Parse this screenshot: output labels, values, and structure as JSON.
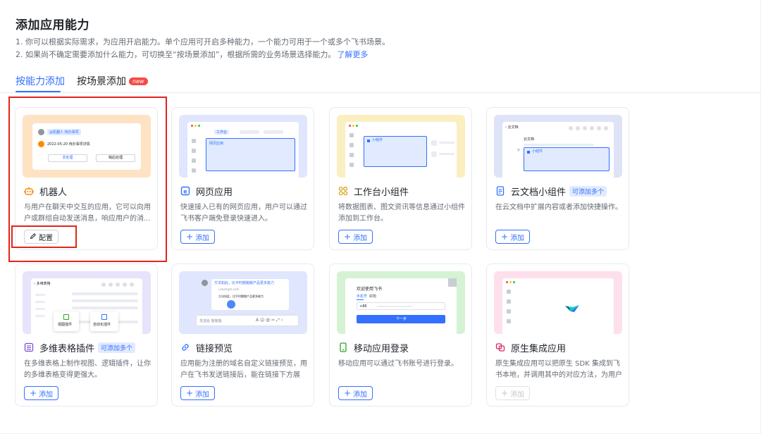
{
  "page": {
    "title": "添加应用能力",
    "desc1": "1. 你可以根据实际需求，为应用开启能力。单个应用可开启多种能力，一个能力可用于一个或多个飞书场景。",
    "desc2": "2. 如果尚不确定需要添加什么能力，可切换至“按场景添加”，根据所需的业务场景选择能力。",
    "learn_more": "了解更多"
  },
  "tabs": [
    {
      "label": "按能力添加",
      "active": true
    },
    {
      "label": "按场景添加",
      "badge": "new"
    }
  ],
  "colors": {
    "accent": "#3370ff",
    "highlight": "#e1251b",
    "badge_red": "#f54a45"
  },
  "cards": [
    {
      "title": "机器人",
      "icon": "robot-icon",
      "icon_color": "#ff8800",
      "desc": "与用户在聊天中交互的应用，它可以向用户或群组自动发送消息，响应用户的消...",
      "button": "配置",
      "button_icon": "edit-icon",
      "highlighted": true,
      "thumb_bg": "#fde2c4",
      "preview": {
        "chip": "@机器人 待办事项",
        "line": "2022-05-20 待办事项详情",
        "btn_a": "去处理",
        "btn_b": "稍后处理"
      }
    },
    {
      "title": "网页应用",
      "icon": "web-icon",
      "icon_color": "#3370ff",
      "desc": "快速接入已有的网页应用，用户可以通过飞书客户端免登录快速进入。",
      "button": "添加",
      "button_icon": "plus-icon",
      "thumb_bg": "#dfe6fd",
      "preview": {
        "tab": "工作台",
        "box": "网页应用"
      }
    },
    {
      "title": "工作台小组件",
      "icon": "widget-icon",
      "icon_color": "#d4a017",
      "desc": "将数据图表、图文资讯等信息通过小组件添加到工作台。",
      "button": "添加",
      "button_icon": "plus-icon",
      "thumb_bg": "#fbeec0",
      "preview": {
        "box": "小组件"
      }
    },
    {
      "title": "云文档小组件",
      "icon": "doc-icon",
      "icon_color": "#3370ff",
      "badge": "可添加多个",
      "desc": "在云文档中扩展内容或者添加快捷操作。",
      "button": "添加",
      "button_icon": "plus-icon",
      "thumb_bg": "#dfe3f7",
      "preview": {
        "header": "云文档",
        "sub": "云文档",
        "box": "小组件"
      }
    },
    {
      "title": "多维表格插件",
      "icon": "table-icon",
      "icon_color": "#7b4fd8",
      "badge": "可添加多个",
      "desc": "在多维表格上制作视图、逻辑插件，让你的多维表格变得更强大。",
      "button": "添加",
      "button_icon": "plus-icon",
      "thumb_bg": "#e6e3fb",
      "preview": {
        "header": "多维表格",
        "plugin_a": "视图插件",
        "plugin_b": "自动化插件"
      }
    },
    {
      "title": "链接预览",
      "icon": "link-icon",
      "icon_color": "#3370ff",
      "desc": "应用能为注册的域名自定义链接预览，用户在飞书发送链接后，能在链接下方展示...",
      "button": "添加",
      "button_icon": "plus-icon",
      "thumb_bg": "#dfe6fd",
      "preview": {
        "msg": "方法如此，比平时搬搬搬产品更多能力",
        "url": "i.example.com",
        "card": "方法如此，比平时搬搬产品更多能力",
        "input": "发送给 搬搬搬"
      }
    },
    {
      "title": "移动应用登录",
      "icon": "mobile-icon",
      "icon_color": "#2ea121",
      "desc": "移动应用可以通过飞书账号进行登录。",
      "button": "添加",
      "button_icon": "plus-icon",
      "thumb_bg": "#d6f2d4",
      "preview": {
        "heading": "欢迎使用飞书",
        "tab_a": "手机号",
        "tab_b": "邮箱",
        "code": "+86",
        "next": "下一步"
      }
    },
    {
      "title": "原生集成应用",
      "icon": "native-icon",
      "icon_color": "#d62b6a",
      "desc": "原生集成应用可以把原生 SDK 集成到飞书本地，并调用其中的对应方法，为用户提...",
      "button": "添加",
      "button_icon": "plus-icon",
      "button_disabled": true,
      "thumb_bg": "#fde0ec",
      "preview": {}
    }
  ]
}
